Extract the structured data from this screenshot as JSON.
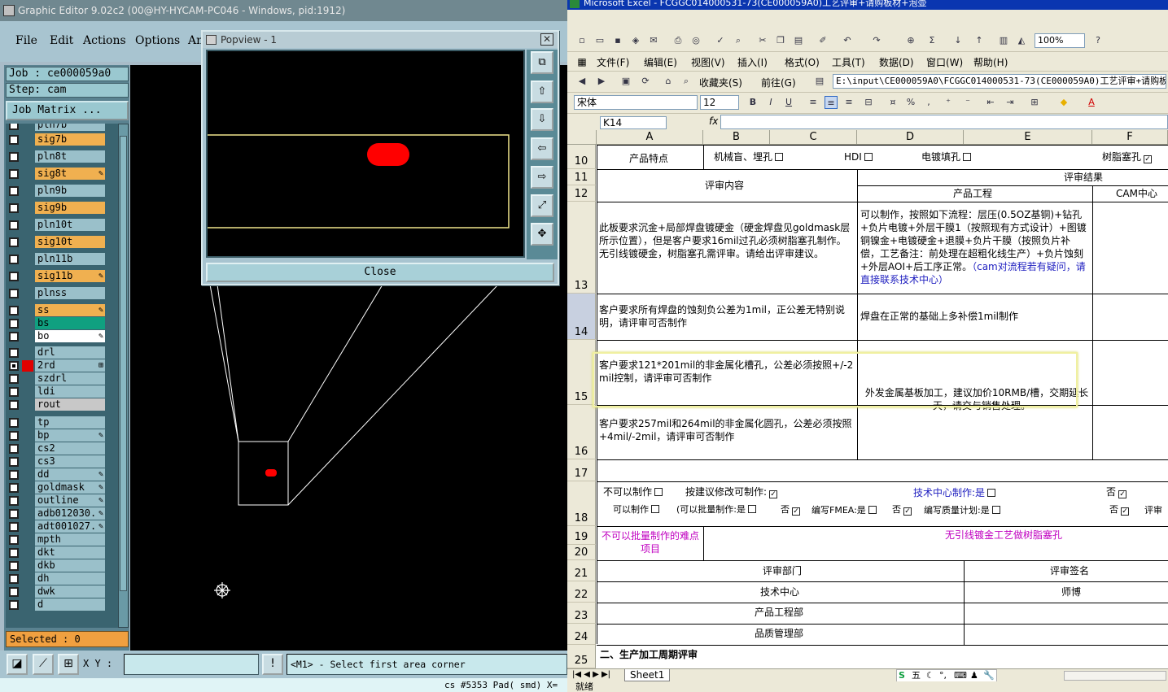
{
  "ge": {
    "title": "Graphic Editor 9.02c2 (00@HY-HYCAM-PC046 - Windows, pid:1912)",
    "menu": [
      "File",
      "Edit",
      "Actions",
      "Options",
      "An"
    ],
    "job": "Job  : ce000059a0",
    "step": "Step: cam",
    "job_matrix": "Job Matrix ...",
    "layers": [
      {
        "name": "pln7b",
        "color": "#9ac0ca",
        "check": "empty",
        "focus": ""
      },
      {
        "name": "sig7b",
        "color": "#f0b050",
        "check": "empty",
        "focus": ""
      },
      {
        "name": "pln8t",
        "color": "#9ac0ca",
        "check": "empty",
        "focus": ""
      },
      {
        "name": "sig8t",
        "color": "#f0b050",
        "check": "empty",
        "focus": "✎"
      },
      {
        "name": "pln9b",
        "color": "#9ac0ca",
        "check": "empty",
        "focus": ""
      },
      {
        "name": "sig9b",
        "color": "#f0b050",
        "check": "empty",
        "focus": ""
      },
      {
        "name": "pln10t",
        "color": "#9ac0ca",
        "check": "empty",
        "focus": ""
      },
      {
        "name": "sig10t",
        "color": "#f0b050",
        "check": "empty",
        "focus": ""
      },
      {
        "name": "pln11b",
        "color": "#9ac0ca",
        "check": "empty",
        "focus": ""
      },
      {
        "name": "sig11b",
        "color": "#f0b050",
        "check": "empty",
        "focus": "✎"
      },
      {
        "name": "plnss",
        "color": "#9ac0ca",
        "check": "empty",
        "focus": ""
      },
      {
        "name": "ss",
        "color": "#f0b050",
        "check": "empty",
        "focus": "✎"
      },
      {
        "name": "bs",
        "color": "#10a080",
        "check": "empty",
        "focus": ""
      },
      {
        "name": "bo",
        "color": "#ffffff",
        "check": "empty",
        "focus": "✎"
      },
      {
        "name": "drl",
        "color": "#9ac0ca",
        "check": "empty",
        "focus": ""
      },
      {
        "name": "2rd",
        "color": "#9ac0ca",
        "check": "filled",
        "focus": "⊞"
      },
      {
        "name": "szdrl",
        "color": "#9ac0ca",
        "check": "empty",
        "focus": ""
      },
      {
        "name": "ldi",
        "color": "#9ac0ca",
        "check": "empty",
        "focus": ""
      },
      {
        "name": "rout",
        "color": "#c8c8c8",
        "check": "empty",
        "focus": ""
      },
      {
        "name": "tp",
        "color": "#9ac0ca",
        "check": "empty",
        "focus": ""
      },
      {
        "name": "bp",
        "color": "#9ac0ca",
        "check": "empty",
        "focus": "✎"
      },
      {
        "name": "cs2",
        "color": "#9ac0ca",
        "check": "empty",
        "focus": ""
      },
      {
        "name": "cs3",
        "color": "#9ac0ca",
        "check": "empty",
        "focus": ""
      },
      {
        "name": "dd",
        "color": "#9ac0ca",
        "check": "empty",
        "focus": "✎"
      },
      {
        "name": "goldmask",
        "color": "#9ac0ca",
        "check": "empty",
        "focus": "✎"
      },
      {
        "name": "outline",
        "color": "#9ac0ca",
        "check": "empty",
        "focus": "✎"
      },
      {
        "name": "adb012030.",
        "color": "#9ac0ca",
        "check": "empty",
        "focus": "✎"
      },
      {
        "name": "adt001027.",
        "color": "#9ac0ca",
        "check": "empty",
        "focus": "✎"
      },
      {
        "name": "mpth",
        "color": "#9ac0ca",
        "check": "empty",
        "focus": ""
      },
      {
        "name": "dkt",
        "color": "#9ac0ca",
        "check": "empty",
        "focus": ""
      },
      {
        "name": "dkb",
        "color": "#9ac0ca",
        "check": "empty",
        "focus": ""
      },
      {
        "name": "dh",
        "color": "#9ac0ca",
        "check": "empty",
        "focus": ""
      },
      {
        "name": "dwk",
        "color": "#9ac0ca",
        "check": "empty",
        "focus": ""
      },
      {
        "name": "d",
        "color": "#9ac0ca",
        "check": "empty",
        "focus": ""
      }
    ],
    "selected": "Selected : 0",
    "xy_label": "X Y :",
    "xy_value": "",
    "message": "<M1> - Select first area corner",
    "status": "cs #5353 Pad( smd) X="
  },
  "popview": {
    "title": "Popview - 1",
    "close_label": "Close"
  },
  "xl": {
    "title": "Microsoft Excel - FCGGC014000531-73(CE000059A0)工艺评审+请购板材+泡壶",
    "menu": [
      "文件(F)",
      "编辑(E)",
      "视图(V)",
      "插入(I)",
      "格式(O)",
      "工具(T)",
      "数据(D)",
      "窗口(W)",
      "帮助(H)"
    ],
    "zoom": "100%",
    "favorites": "收藏夹(S)",
    "goto": "前往(G)",
    "address": "E:\\input\\CE000059A0\\FCGGC014000531-73(CE000059A0)工艺评审+请购板材",
    "font": "宋体",
    "font_size": "12",
    "name_box": "K14",
    "fx": "fx",
    "columns": [
      "A",
      "B",
      "C",
      "D",
      "E",
      "F"
    ],
    "rows": [
      "10",
      "11",
      "12",
      "13",
      "14",
      "15",
      "16",
      "17",
      "18",
      "19",
      "20",
      "21",
      "22",
      "23",
      "24",
      "25"
    ],
    "cells": {
      "r10a": "产品特点",
      "r10b": "机械盲、埋孔",
      "r10c": "HDI",
      "r10d": "电镀填孔",
      "r10f": "树脂塞孔",
      "review_content": "评审内容",
      "review_result": "评审结果",
      "product_eng": "产品工程",
      "cam_center": "CAM中心",
      "r13a": "此板要求沉金+局部焊盘镀硬金（硬金焊盘见goldmask层所示位置），但是客户要求16mil过孔必须树脂塞孔制作。无引线镀硬金，树脂塞孔需评审。请给出评审建议。",
      "r13e_black": "可以制作，按照如下流程：层压(0.5OZ基铜)+钻孔+负片电镀+外层干膜1（按照现有方式设计）+图镀铜镍金+电镀硬金+退膜+负片干膜（按照负片补偿，工艺备注：前处理在超粗化线生产）+负片蚀刻+外层AOI+后工序正常。",
      "r13e_blue": "（cam对流程若有疑问，请直接联系技术中心）",
      "r14a": "客户要求所有焊盘的蚀刻负公差为1mil，正公差无特别说明，请评审可否制作",
      "r14e": "焊盘在正常的基础上多补偿1mil制作",
      "r15a": "客户要求121*201mil的非金属化槽孔，公差必须按照+/-2mil控制，请评审可否制作",
      "r15e": "外发金属基板加工，建议加价10RMB/槽，交期延长一天，请交与销售处理。",
      "r16a": "客户要求257mil和264mil的非金属化圆孔，公差必须按照+4mil/-2mil，请评审可否制作",
      "r18_cannot": "不可以制作",
      "r18_suggest": "按建议修改可制作:",
      "r18_tech": "技术中心制作:是",
      "r18_no": "否",
      "r18_can": "可以制作",
      "r18_batch": "(可以批量制作:是",
      "r18_no2": "否",
      "r18_fmea": "编写FMEA:是",
      "r18_no3": "否",
      "r18_plan": "编写质量计划:是",
      "r18_no4": "否",
      "r18_review": "评审",
      "r19a": "不可以批量制作的难点项目",
      "r19e": "无引线镀金工艺做树脂塞孔",
      "r21a": "评审部门",
      "r21e": "评审签名",
      "r22a": "技术中心",
      "r22e": "师博",
      "r23a": "产品工程部",
      "r24a": "品质管理部",
      "r25a": "二、生产加工周期评审"
    },
    "sheet_tab": "Sheet1",
    "status": "就绪",
    "ime": "五"
  }
}
